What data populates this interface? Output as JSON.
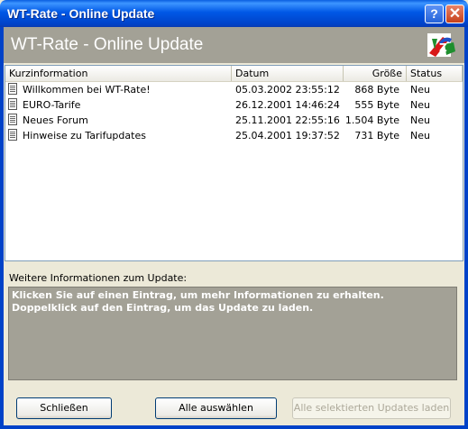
{
  "window": {
    "title": "WT-Rate - Online Update",
    "help_glyph": "?",
    "close_glyph": "✕"
  },
  "banner": {
    "heading": "WT-Rate - Online Update",
    "logo_icon": "wt-rate-logo-icon"
  },
  "list": {
    "columns": [
      "Kurzinformation",
      "Datum",
      "Größe",
      "Status"
    ],
    "rows": [
      {
        "title": "Willkommen bei WT-Rate!",
        "date": "05.03.2002 23:55:12",
        "size": "868 Byte",
        "status": "Neu"
      },
      {
        "title": "EURO-Tarife",
        "date": "26.12.2001 14:46:24",
        "size": "555 Byte",
        "status": "Neu"
      },
      {
        "title": "Neues Forum",
        "date": "25.11.2001 22:55:16",
        "size": "1.504 Byte",
        "status": "Neu"
      },
      {
        "title": "Hinweise zu Tarifupdates",
        "date": "25.04.2001 19:37:52",
        "size": "731 Byte",
        "status": "Neu"
      }
    ]
  },
  "info": {
    "label": "Weitere Informationen zum Update:",
    "line1": "Klicken Sie auf einen Eintrag, um mehr Informationen zu erhalten.",
    "line2": "Doppelklick auf den Eintrag, um das Update zu laden."
  },
  "buttons": {
    "close": "Schließen",
    "select_all": "Alle auswählen",
    "load_selected": "Alle selektierten Updates laden"
  }
}
